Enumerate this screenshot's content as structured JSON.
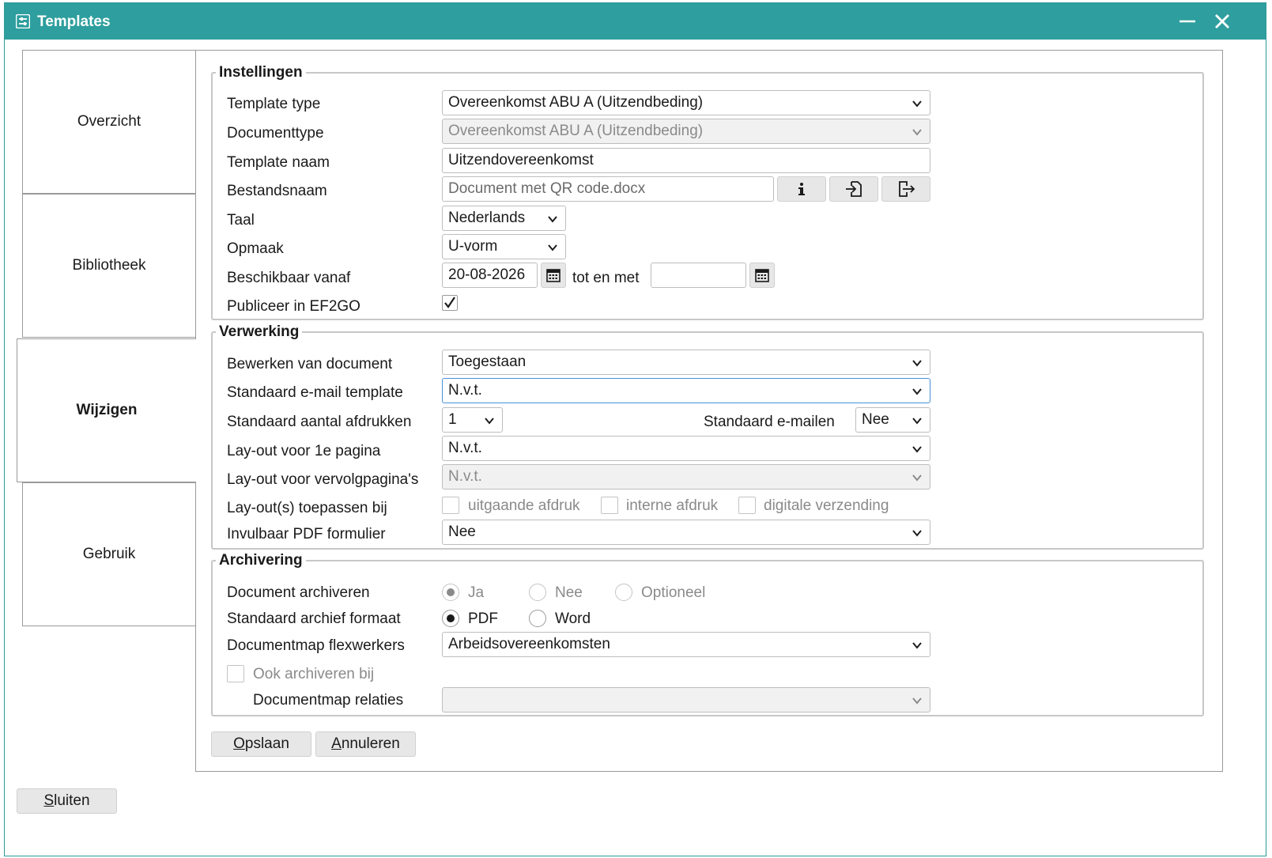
{
  "window": {
    "title": "Templates"
  },
  "tabs": [
    {
      "label": "Overzicht"
    },
    {
      "label": "Bibliotheek"
    },
    {
      "label": "Wijzigen"
    },
    {
      "label": "Gebruik"
    }
  ],
  "instellingen": {
    "legend": "Instellingen",
    "template_type": {
      "label": "Template type",
      "value": "Overeenkomst ABU A (Uitzendbeding)"
    },
    "documenttype": {
      "label": "Documenttype",
      "value": "Overeenkomst ABU A (Uitzendbeding)"
    },
    "template_naam": {
      "label": "Template naam",
      "value": "Uitzendovereenkomst"
    },
    "bestandsnaam": {
      "label": "Bestandsnaam",
      "placeholder": "Document met QR code.docx"
    },
    "taal": {
      "label": "Taal",
      "value": "Nederlands"
    },
    "opmaak": {
      "label": "Opmaak",
      "value": "U-vorm"
    },
    "beschikbaar": {
      "label": "Beschikbaar vanaf",
      "from": "20-08-2026",
      "to_label": "tot en met",
      "to": ""
    },
    "publiceer": {
      "label": "Publiceer in EF2GO",
      "checked": true
    }
  },
  "verwerking": {
    "legend": "Verwerking",
    "bewerken": {
      "label": "Bewerken van document",
      "value": "Toegestaan"
    },
    "email_template": {
      "label": "Standaard e-mail template",
      "value": "N.v.t."
    },
    "afdrukken": {
      "label": "Standaard aantal afdrukken",
      "value": "1"
    },
    "emailen": {
      "label": "Standaard e-mailen",
      "value": "Nee"
    },
    "layout_eerste": {
      "label": "Lay-out voor 1e pagina",
      "value": "N.v.t."
    },
    "layout_vervolg": {
      "label": "Lay-out voor vervolgpagina's",
      "value": "N.v.t."
    },
    "toepassen": {
      "label": "Lay-out(s) toepassen bij",
      "options": [
        "uitgaande afdruk",
        "interne afdruk",
        "digitale verzending"
      ]
    },
    "pdf_formulier": {
      "label": "Invulbaar PDF formulier",
      "value": "Nee"
    }
  },
  "archivering": {
    "legend": "Archivering",
    "archiveren": {
      "label": "Document archiveren",
      "options": [
        "Ja",
        "Nee",
        "Optioneel"
      ],
      "selected": "Ja"
    },
    "formaat": {
      "label": "Standaard archief formaat",
      "options": [
        "PDF",
        "Word"
      ],
      "selected": "PDF"
    },
    "map_flexwerkers": {
      "label": "Documentmap flexwerkers",
      "value": "Arbeidsovereenkomsten"
    },
    "ook_archiveren": {
      "label": "Ook archiveren bij",
      "checked": false
    },
    "map_relaties": {
      "label": "Documentmap relaties",
      "value": ""
    }
  },
  "actions": {
    "save": {
      "prefix": "O",
      "rest": "pslaan"
    },
    "cancel": {
      "prefix": "A",
      "rest": "nnuleren"
    },
    "close": {
      "prefix": "S",
      "rest": "luiten"
    }
  },
  "colors": {
    "titlebar": "#2e9e9e",
    "focus": "#4a90d9"
  }
}
